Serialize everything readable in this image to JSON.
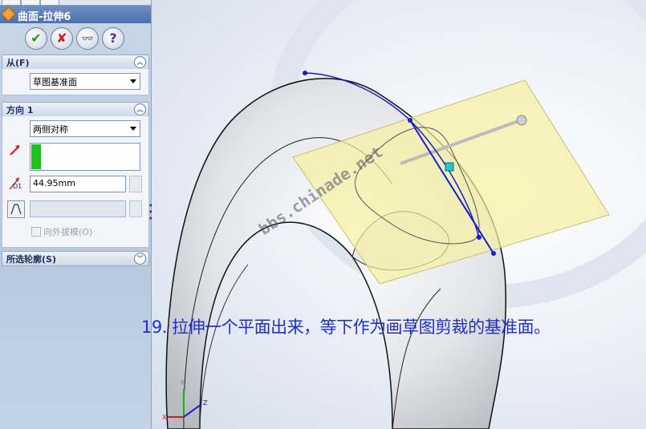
{
  "feature": {
    "title": "曲面-拉伸6"
  },
  "actions": {
    "ok": "✔",
    "cancel": "✘",
    "preview": "👓",
    "help": "?"
  },
  "from_section": {
    "label": "从(F)",
    "value": "草图基准面"
  },
  "direction1": {
    "label": "方向 1",
    "end_condition": "两侧对称",
    "depth_icon_label": "D1",
    "depth": "44.95mm",
    "draft_outward": "向外拔模(O)"
  },
  "selected_contours": {
    "label": "所选轮廓(S)"
  },
  "caption": "19. 拉伸一个平面出来，等下作为画草图剪裁的基准面。",
  "watermark": "bbs.chinade.net",
  "triad": {
    "x": "X",
    "y": "Y",
    "z": "Z"
  },
  "colors": {
    "caption": "#1f2fd2",
    "sketch_line": "#1a1ad0",
    "plane": "#f5f0a0"
  }
}
